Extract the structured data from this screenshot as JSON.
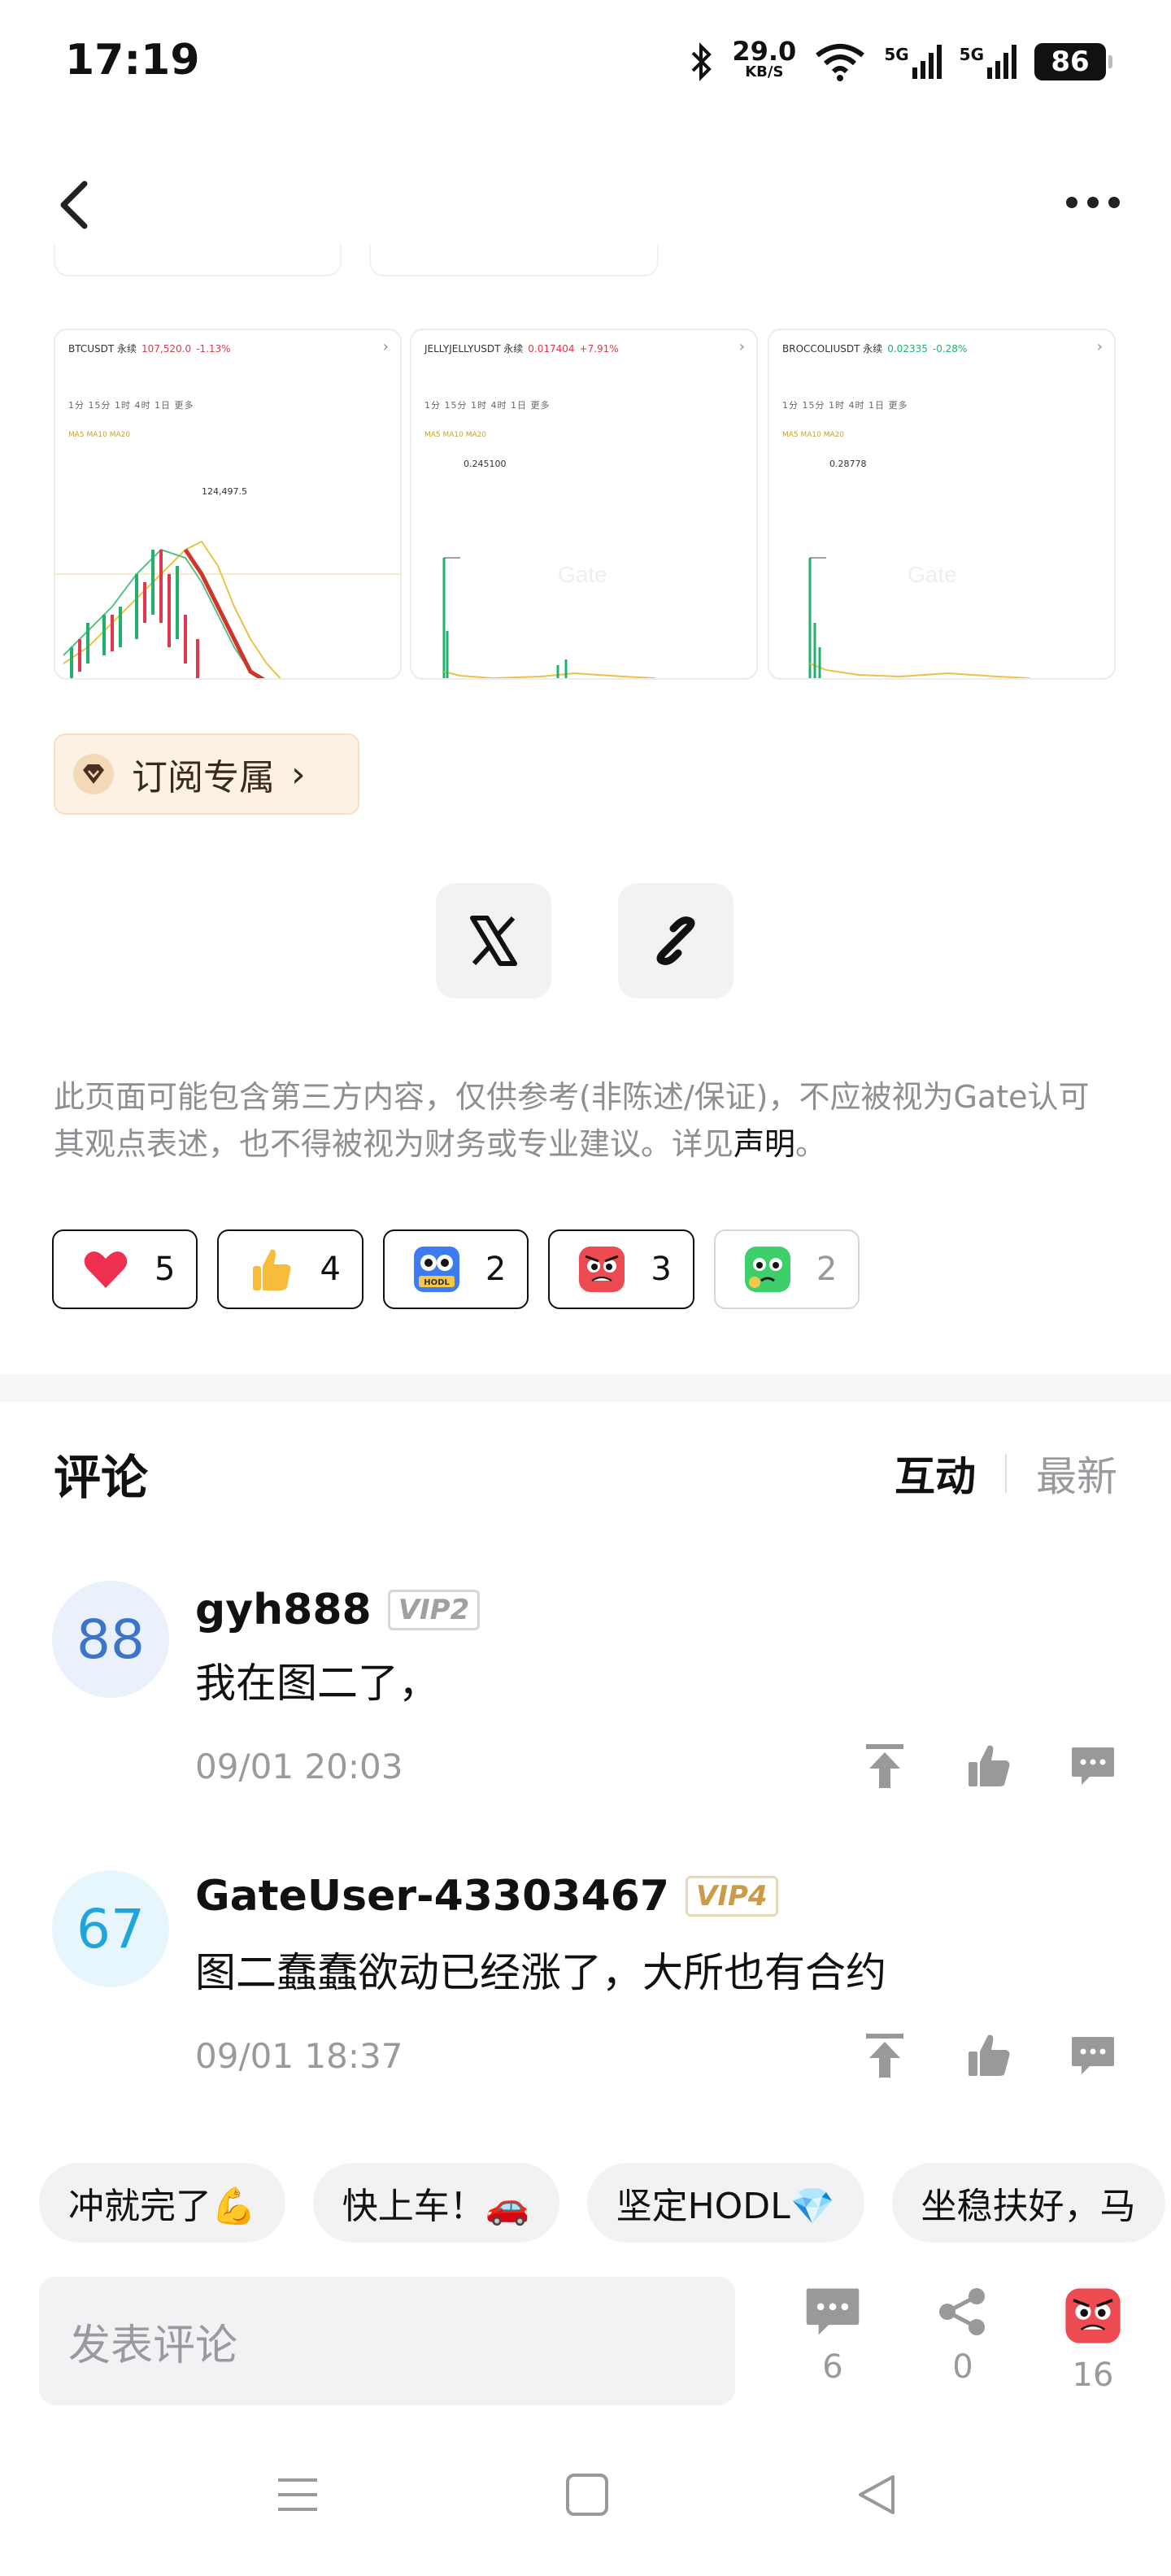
{
  "status_bar": {
    "time": "17:19",
    "net_speed": "29.0",
    "net_unit": "KB/S",
    "signal1": "5G",
    "signal2": "5G",
    "battery": "86"
  },
  "charts": [
    {
      "symbol": "BTCUSDT 永续",
      "price": "107,520.0",
      "change": "-1.13%",
      "change_dir": "down",
      "tabs": "1分 15分 1时 4时 1日 更多",
      "high_label": "124,497.5"
    },
    {
      "symbol": "JELLYJELLYUSDT 永续",
      "price": "0.017404",
      "change": "+7.91%",
      "change_dir": "up",
      "tabs": "1分 15分 1时 4时 1日 更多",
      "high_label": "0.245100"
    },
    {
      "symbol": "BROCCOLIUSDT 永续",
      "price": "0.02335",
      "change": "-0.28%",
      "change_dir": "up",
      "tabs": "1分 15分 1时 4时 1日 更多",
      "high_label": "0.28778"
    }
  ],
  "subscribe": {
    "label": "订阅专属",
    "chevron": "›"
  },
  "disclaimer": {
    "text": "此页面可能包含第三方内容，仅供参考(非陈述/保证)，不应被视为Gate认可其观点表述，也不得被视为财务或专业建议。详见",
    "link": "声明",
    "end": "。"
  },
  "reactions": [
    {
      "emoji": "heart-icon",
      "count": "5"
    },
    {
      "emoji": "thumbs-up-icon",
      "count": "4"
    },
    {
      "emoji": "hodl-owl-icon",
      "count": "2"
    },
    {
      "emoji": "angry-face-icon",
      "count": "3"
    },
    {
      "emoji": "green-face-icon",
      "count": "2"
    }
  ],
  "comments_section": {
    "title": "评论",
    "sort_active": "互动",
    "sort_inactive": "最新"
  },
  "comments": [
    {
      "avatar": "88",
      "username": "gyh888",
      "vip": "VIP2",
      "text": "我在图二了，",
      "time": "09/01 20:03"
    },
    {
      "avatar": "67",
      "username": "GateUser-43303467",
      "vip": "VIP4",
      "text": "图二蠢蠢欲动已经涨了，大所也有合约",
      "time": "09/01 18:37"
    }
  ],
  "quick_replies": [
    "冲就完了💪",
    "快上车！🚗",
    "坚定HODL💎",
    "坐稳扶好，马"
  ],
  "bottom_bar": {
    "input_placeholder": "发表评论",
    "comments_count": "6",
    "shares_count": "0",
    "reactions_count": "16"
  },
  "colors": {
    "accent_up": "#20b26c",
    "accent_down": "#e0384e",
    "vip2": "#a0a0a4",
    "vip4": "#c99b4a"
  }
}
